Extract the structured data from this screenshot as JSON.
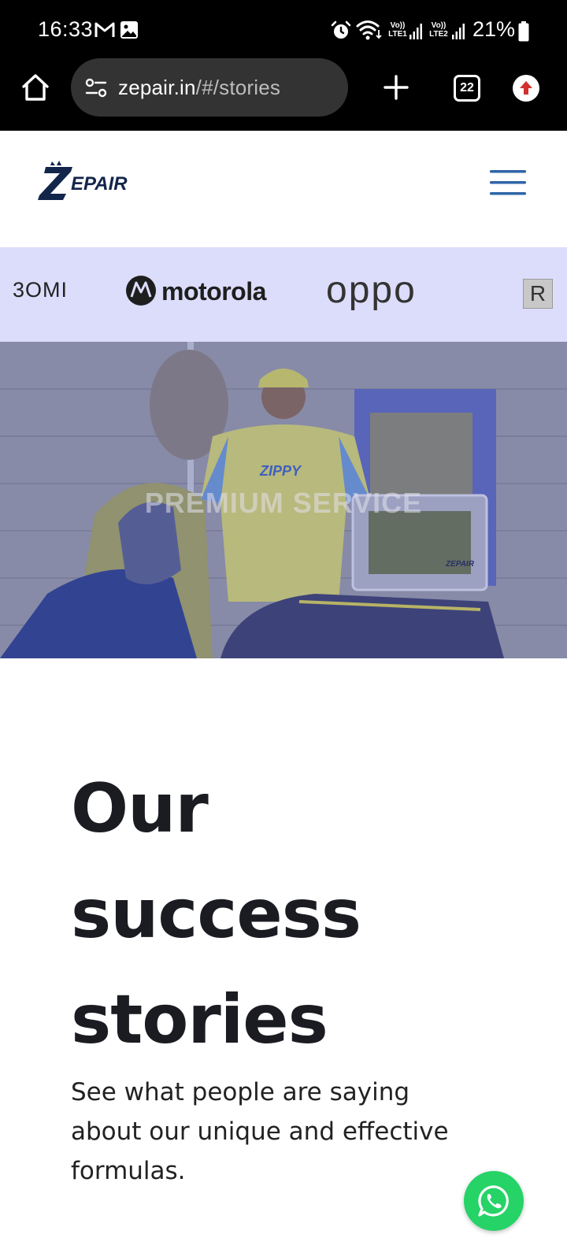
{
  "status_bar": {
    "time": "16:33",
    "notification_icons": [
      "gmail-icon",
      "gallery-icon"
    ],
    "system_icons": [
      "alarm-icon",
      "wifi-icon",
      "signal-sim1-icon",
      "signal-sim2-icon"
    ],
    "sim1_label_top": "Vo))",
    "sim1_label_bottom": "LTE1",
    "sim2_label_top": "Vo))",
    "sim2_label_bottom": "LTE2",
    "battery_percent": "21%"
  },
  "browser": {
    "url_host": "zepair.in",
    "url_path": "/#/stories",
    "open_tabs": "22",
    "icons": [
      "home-icon",
      "site-settings-icon",
      "new-tab-icon",
      "tab-switcher-icon",
      "update-icon"
    ]
  },
  "header": {
    "logo_text": "ZEPAIR",
    "menu_icon": "hamburger-menu-icon",
    "accent_color": "#2f65a8",
    "logo_color": "#13254a"
  },
  "brand_strip": {
    "background": "#dcdcfb",
    "brands": [
      "3OMI",
      "motorola",
      "oppo",
      "R"
    ]
  },
  "hero": {
    "caption": "PREMIUM SERVICE",
    "shirt_text": "ZIPPY",
    "box_text": "ZEPAIR"
  },
  "content": {
    "title_line1": "Our",
    "title_line2": "success",
    "title_line3": "stories",
    "description": "See what people are saying about our unique and effective formulas."
  },
  "fab": {
    "icon": "whatsapp-icon",
    "color": "#25d366"
  }
}
